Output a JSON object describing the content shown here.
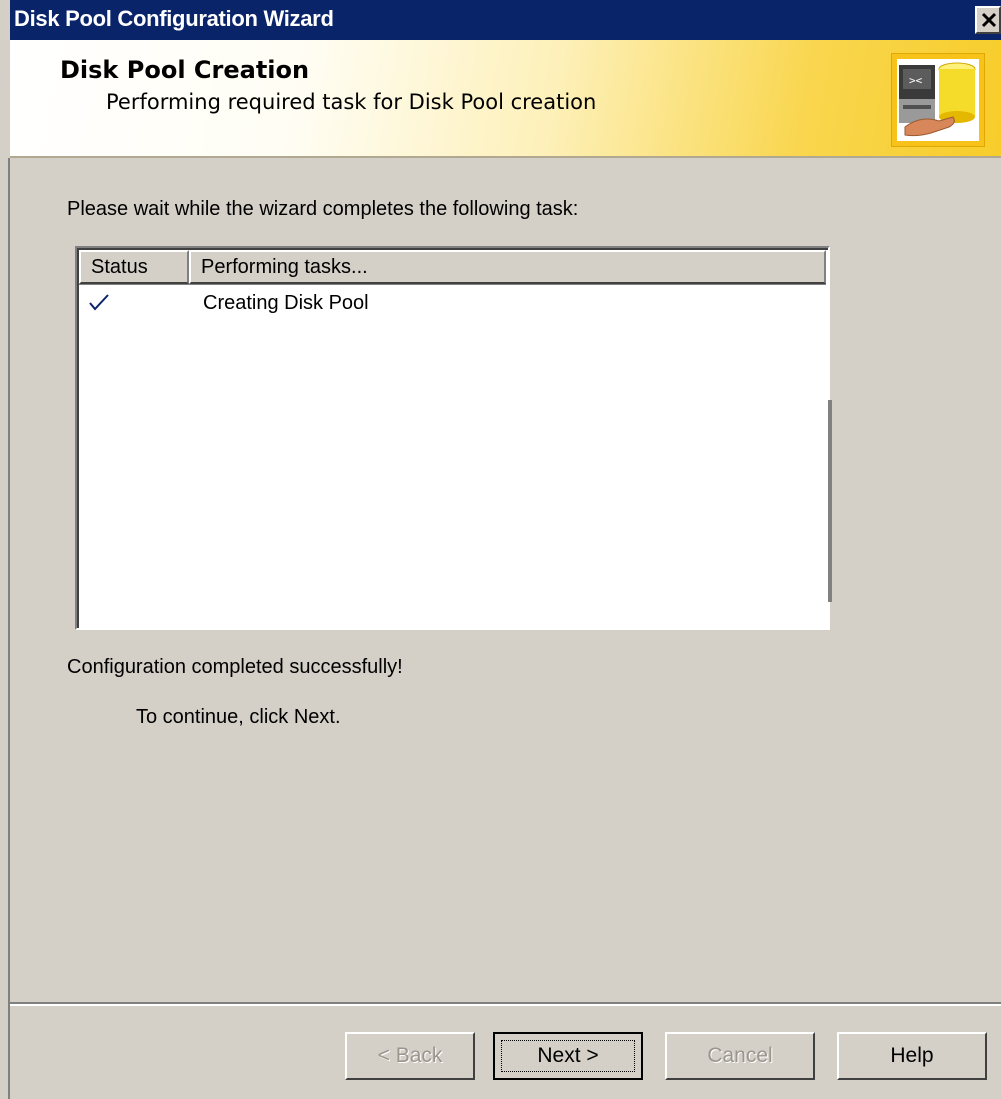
{
  "window": {
    "title": "Disk Pool Configuration Wizard"
  },
  "header": {
    "title": "Disk Pool Creation",
    "subtitle": "Performing required task for Disk Pool creation",
    "icon": "disk-pool-wizard-icon"
  },
  "content": {
    "intro": "Please wait while the wizard completes the following task:",
    "task_list": {
      "columns": [
        "Status",
        "Performing tasks..."
      ],
      "rows": [
        {
          "status_icon": "checkmark-icon",
          "task": "Creating Disk Pool"
        }
      ]
    },
    "result": "Configuration completed successfully!",
    "instruction": "To continue, click Next."
  },
  "buttons": {
    "back": "< Back",
    "next": "Next >",
    "cancel": "Cancel",
    "help": "Help"
  },
  "colors": {
    "titlebar": "#0a246a",
    "dialog_face": "#d4d0c8",
    "header_gradient_end": "#f7cd2a",
    "checkmark": "#0a246a"
  }
}
